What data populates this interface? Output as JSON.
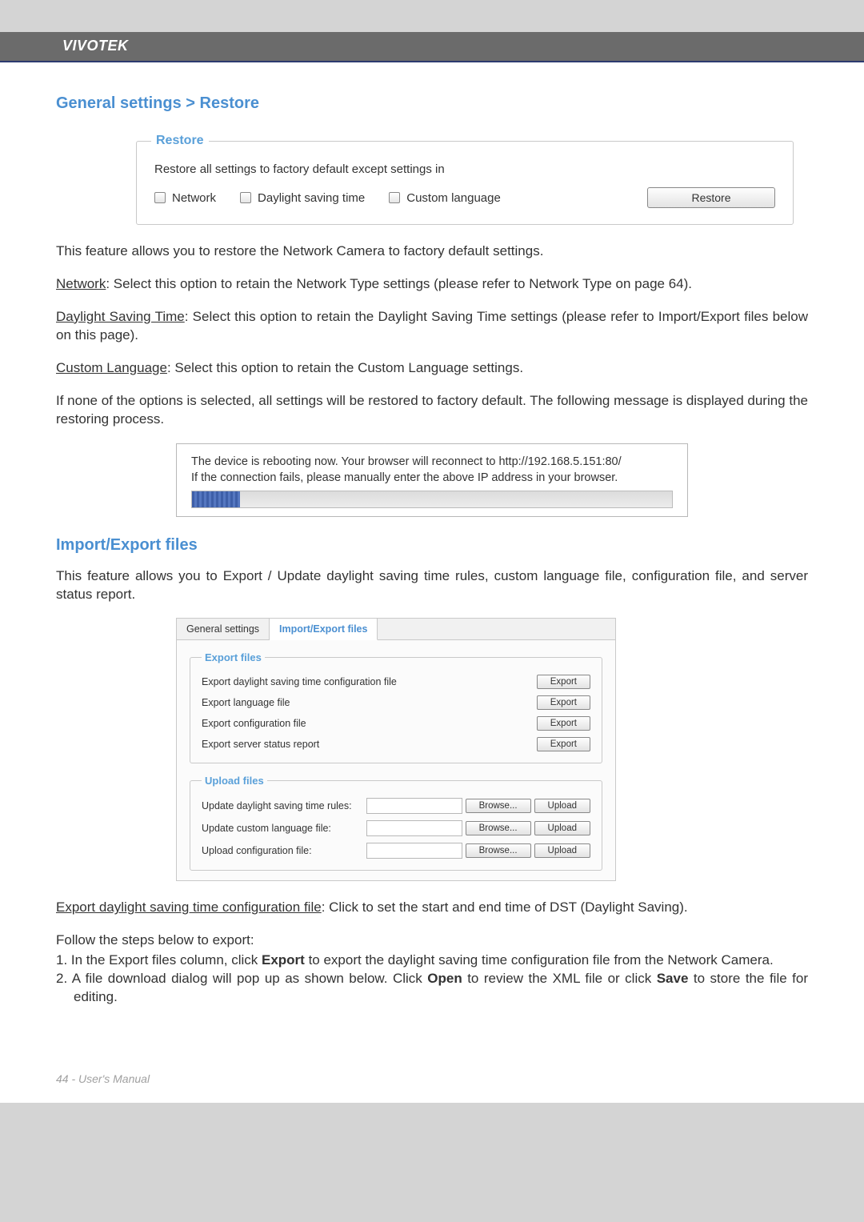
{
  "brand": "VIVOTEK",
  "section1_title": "General settings > Restore",
  "restore": {
    "legend": "Restore",
    "desc": "Restore all settings to factory default except settings in",
    "opt1": "Network",
    "opt2": "Daylight saving time",
    "opt3": "Custom language",
    "button": "Restore"
  },
  "para_intro": "This feature allows you to restore the Network Camera to factory default settings.",
  "network_label": "Network",
  "network_text": ": Select this option to retain the Network Type settings (please refer to Network Type on page 64).",
  "dst_label": "Daylight Saving Time",
  "dst_text": ": Select this option to retain the Daylight Saving Time settings (please refer to Import/Export files below on this page).",
  "cl_label": "Custom Language",
  "cl_text": ": Select this option to retain the Custom Language settings.",
  "none_text": "If none of the options is selected, all settings will be restored to factory default.  The following message is displayed during the restoring process.",
  "reboot": {
    "line1": "The device is rebooting now. Your browser will reconnect to http://192.168.5.151:80/",
    "line2": "If the connection fails, please manually enter the above IP address in your browser."
  },
  "section2_title": "Import/Export files",
  "ie_intro": "This feature allows you to Export / Update daylight saving time rules, custom language file, configuration file, and server status report.",
  "tabs": {
    "t1": "General settings",
    "t2": "Import/Export files"
  },
  "export": {
    "legend": "Export files",
    "r1": "Export daylight saving time configuration file",
    "r2": "Export language file",
    "r3": "Export configuration file",
    "r4": "Export server status report",
    "btn": "Export"
  },
  "upload": {
    "legend": "Upload files",
    "r1": "Update daylight saving time rules:",
    "r2": "Update custom language file:",
    "r3": "Upload configuration file:",
    "browse": "Browse...",
    "upload_btn": "Upload"
  },
  "exp_dst_label": "Export daylight saving time configuration file",
  "exp_dst_text": ": Click to set the start and end time of DST (Daylight Saving).",
  "follow_steps": "Follow the steps below to export:",
  "step1_a": "1. In the Export files column, click ",
  "step1_b": "Export",
  "step1_c": " to export the daylight saving time configuration file from the Network Camera.",
  "step2_a": "2. A file download dialog will pop up as shown below. Click ",
  "step2_b": "Open",
  "step2_c": " to review the XML file or click ",
  "step2_d": "Save",
  "step2_e": " to store the file for editing.",
  "footer": "44 - User's Manual"
}
